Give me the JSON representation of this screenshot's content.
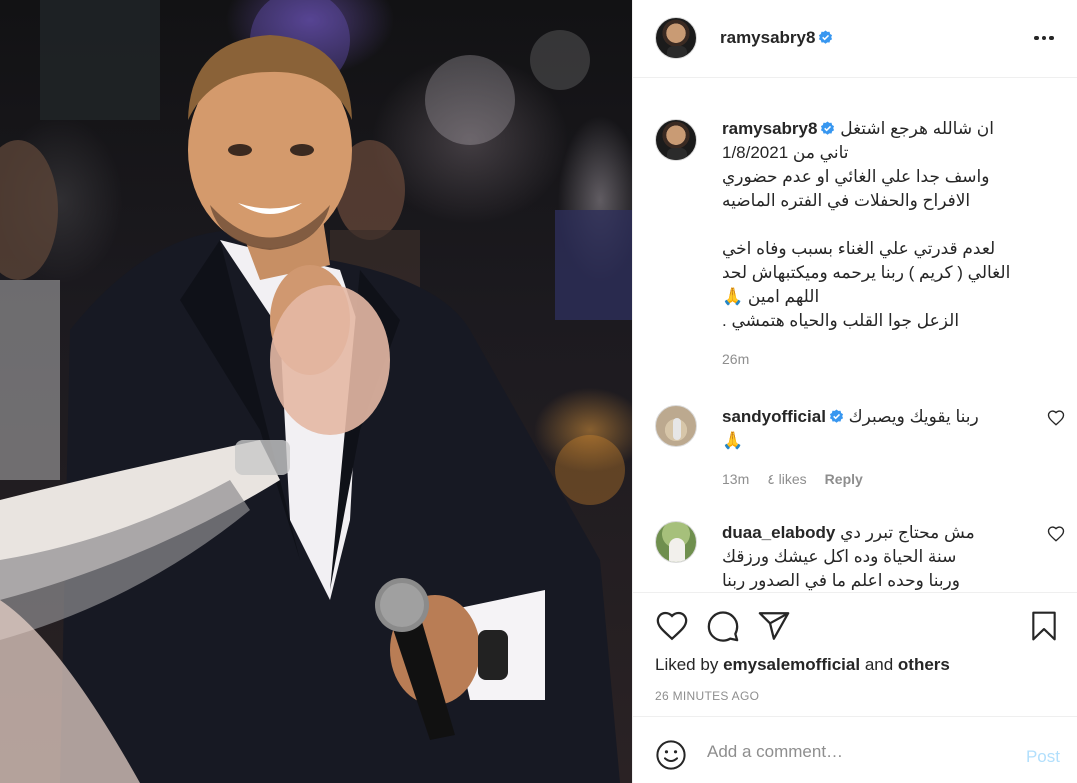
{
  "post": {
    "author": "ramysabry8",
    "verified": true,
    "photo_alt": ""
  },
  "caption": {
    "username": "ramysabry8",
    "lines": [
      "ان شالله هرجع اشتغل",
      "تاني من 1/8/2021",
      "واسف جدا علي الغائي او عدم حضوري",
      "الافراح والحفلات في الفتره الماضيه",
      "",
      "لعدم قدرتي علي الغناء بسبب وفاه اخي",
      "الغالي ( كريم ) ربنا يرحمه وميكتبهاش لحد",
      "اللهم امين 🙏",
      "الزعل جوا القلب والحياه هتمشي ."
    ],
    "time": "26m"
  },
  "comments": [
    {
      "username": "sandyofficial",
      "verified": true,
      "text_lines": [
        "ربنا يقويك ويصبرك",
        "🙏"
      ],
      "time": "13m",
      "likes": "٤ likes",
      "reply": "Reply"
    },
    {
      "username": "duaa_elabody",
      "verified": false,
      "text_lines": [
        "مش محتاج تبرر دي",
        "سنة الحياة وده اكل عيشك ورزقك",
        "وربنا وحده اعلم ما في الصدور ربنا"
      ],
      "time": "",
      "likes": "",
      "reply": ""
    }
  ],
  "actions": {
    "liked_by_prefix": "Liked by",
    "liked_by_user": "emysalemofficial",
    "liked_by_and": "and",
    "liked_by_others": "others",
    "post_time": "26 MINUTES AGO"
  },
  "add_comment": {
    "placeholder": "Add a comment…",
    "post_label": "Post"
  },
  "colors": {
    "verified_blue": "#3897f0",
    "post_button_disabled": "#b2dffc",
    "muted_text": "#8e8e8e"
  },
  "icons": [
    "more-options-icon",
    "verified-badge-icon",
    "heart-icon",
    "comment-icon",
    "share-icon",
    "bookmark-icon",
    "emoji-icon"
  ]
}
